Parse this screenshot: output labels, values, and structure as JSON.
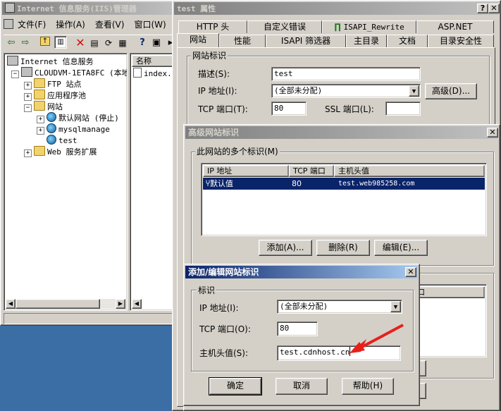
{
  "iis": {
    "title": "Internet 信息服务(IIS)管理器",
    "menu": [
      "文件(F)",
      "操作(A)",
      "查看(V)",
      "窗口(W)"
    ],
    "tree": {
      "root": "Internet 信息服务",
      "server": "CLOUDVM-1ETA8FC (本地计",
      "ftp": "FTP 站点",
      "pools": "应用程序池",
      "websites": "网站",
      "default_site": "默认网站 (停止)",
      "mysql": "mysqlmanage",
      "test": "test",
      "webext": "Web 服务扩展"
    },
    "list": {
      "col_name": "名称",
      "item": "index.!"
    }
  },
  "props": {
    "title": "test 属性",
    "help_btn": "?",
    "close_btn": "✕",
    "tabs_row1": [
      "HTTP 头",
      "自定义错误",
      "ISAPI_Rewrite",
      "ASP.NET"
    ],
    "tabs_row2": [
      "网站",
      "性能",
      "ISAPI 筛选器",
      "主目录",
      "文档",
      "目录安全性"
    ],
    "group_title": "网站标识",
    "desc_label": "描述(S):",
    "desc_value": "test",
    "ip_label": "IP 地址(I):",
    "ip_value": "(全部未分配)",
    "advanced_btn": "高级(D)...",
    "tcp_label": "TCP 端口(T):",
    "tcp_value": "80",
    "ssl_label": "SSL 端口(L):",
    "ssl_value": ""
  },
  "advanced": {
    "title": "高级网站标识",
    "close_btn": "✕",
    "group_title": "此网站的多个标识(M)",
    "columns": [
      "IP 地址",
      "TCP 端口",
      "主机头值"
    ],
    "rows": [
      {
        "ip": "默认值",
        "port": "80",
        "host": "test.web985258.com"
      }
    ],
    "add_btn": "添加(A)...",
    "remove_btn": "删除(R)",
    "edit_btn": "编辑(E)...",
    "second_col_label": "口"
  },
  "addedit": {
    "title": "添加/编辑网站标识",
    "close_btn": "✕",
    "group_title": "标识",
    "ip_label": "IP 地址(I):",
    "ip_value": "(全部未分配)",
    "tcp_label": "TCP 端口(O):",
    "tcp_value": "80",
    "host_label": "主机头值(S):",
    "host_value": "test.cdnhost.cn",
    "ok_btn": "确定",
    "cancel_btn": "取消",
    "help_btn": "帮助(H)"
  },
  "colors": {
    "title_active": "#0a246a",
    "title_inactive": "#808080",
    "selection": "#0a246a",
    "arrow": "#e8201b",
    "desktop": "#3a6ea5"
  }
}
